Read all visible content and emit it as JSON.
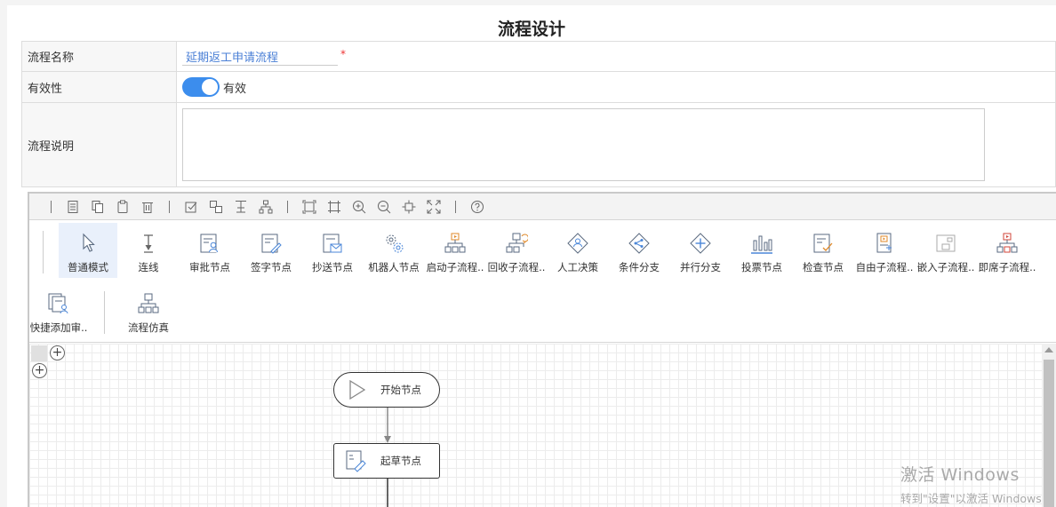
{
  "page_title": "流程设计",
  "form": {
    "name_label": "流程名称",
    "name_value": "延期返工申请流程",
    "required_mark": "*",
    "validity_label": "有效性",
    "validity_toggle_on": true,
    "validity_text": "有效",
    "desc_label": "流程说明",
    "desc_value": ""
  },
  "toolbar": {
    "icons": [
      "page-icon",
      "copy-icon",
      "paste-icon",
      "delete-icon",
      "select-all-icon",
      "group-icon",
      "align-icon",
      "layout-icon",
      "fit-icon",
      "actual-size-icon",
      "zoom-in-icon",
      "zoom-out-icon",
      "center-icon",
      "fullscreen-icon",
      "help-icon"
    ]
  },
  "palette": {
    "items": [
      {
        "label": "普通模式",
        "icon": "cursor-icon",
        "active": true
      },
      {
        "label": "连线",
        "icon": "connector-icon"
      },
      {
        "label": "审批节点",
        "icon": "approval-node-icon"
      },
      {
        "label": "签字节点",
        "icon": "sign-node-icon"
      },
      {
        "label": "抄送节点",
        "icon": "cc-node-icon"
      },
      {
        "label": "机器人节点",
        "icon": "robot-node-icon"
      },
      {
        "label": "启动子流程..",
        "icon": "start-subflow-icon"
      },
      {
        "label": "回收子流程..",
        "icon": "recycle-subflow-icon"
      },
      {
        "label": "人工决策",
        "icon": "manual-decision-icon"
      },
      {
        "label": "条件分支",
        "icon": "condition-branch-icon"
      },
      {
        "label": "并行分支",
        "icon": "parallel-branch-icon"
      },
      {
        "label": "投票节点",
        "icon": "vote-node-icon"
      },
      {
        "label": "检查节点",
        "icon": "check-node-icon"
      },
      {
        "label": "自由子流程..",
        "icon": "free-subflow-icon"
      },
      {
        "label": "嵌入子流程..",
        "icon": "embed-subflow-icon"
      },
      {
        "label": "即席子流程..",
        "icon": "adhoc-subflow-icon"
      },
      {
        "label": "快捷添加审..",
        "icon": "quick-add-icon"
      },
      {
        "label": "流程仿真",
        "icon": "simulation-icon"
      }
    ]
  },
  "canvas": {
    "nodes": [
      {
        "label": "开始节点",
        "type": "start"
      },
      {
        "label": "起草节点",
        "type": "draft"
      }
    ]
  },
  "watermark": {
    "line1": "激活 Windows",
    "line2": "转到\"设置\"以激活 Windows"
  }
}
